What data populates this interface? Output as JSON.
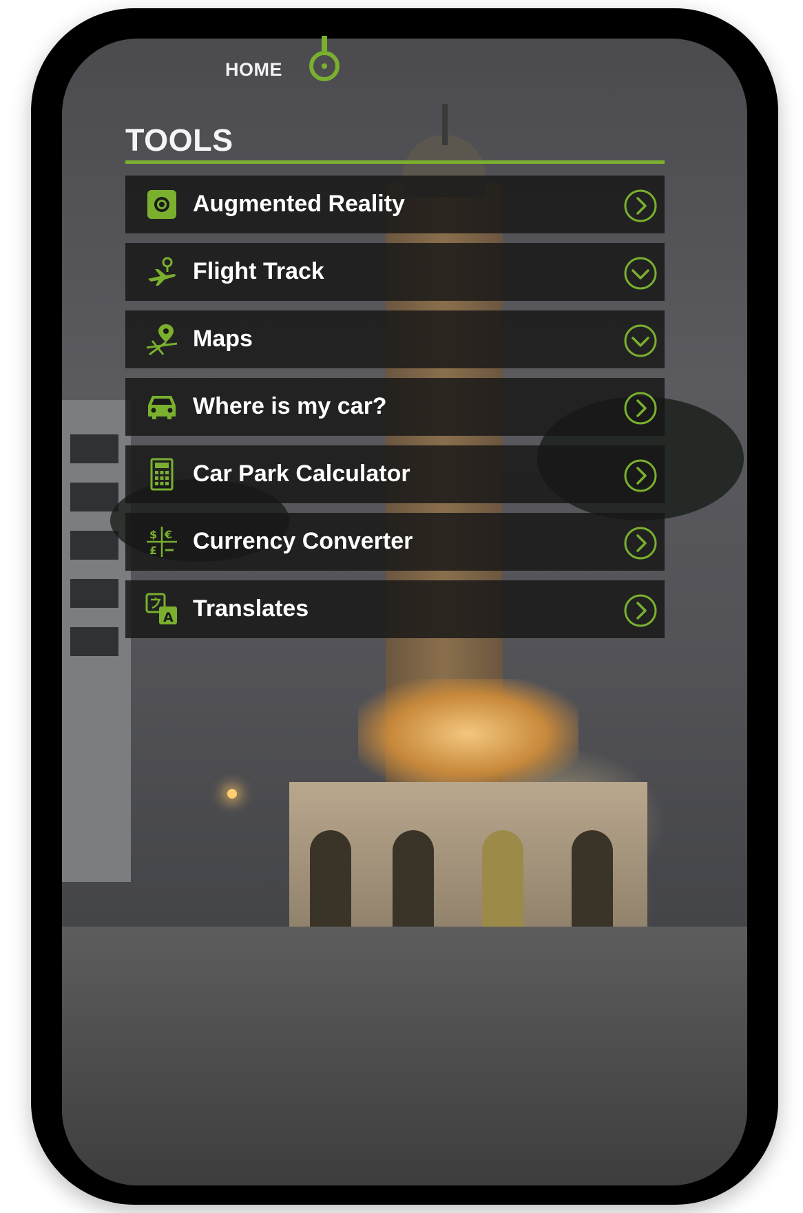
{
  "colors": {
    "accent": "#7ab02e",
    "row_bg": "#161616",
    "text": "#ffffff"
  },
  "nav": {
    "home_label": "HOME"
  },
  "section": {
    "title": "TOOLS"
  },
  "menu": {
    "items": [
      {
        "label": "Augmented Reality",
        "icon": "camera-icon",
        "chevron": "right"
      },
      {
        "label": "Flight Track",
        "icon": "flight-icon",
        "chevron": "down"
      },
      {
        "label": "Maps",
        "icon": "map-pin-icon",
        "chevron": "down"
      },
      {
        "label": "Where is my car?",
        "icon": "car-icon",
        "chevron": "right"
      },
      {
        "label": "Car Park Calculator",
        "icon": "calculator-icon",
        "chevron": "right"
      },
      {
        "label": "Currency Converter",
        "icon": "currency-icon",
        "chevron": "right"
      },
      {
        "label": "Translates",
        "icon": "translate-icon",
        "chevron": "right"
      }
    ]
  }
}
